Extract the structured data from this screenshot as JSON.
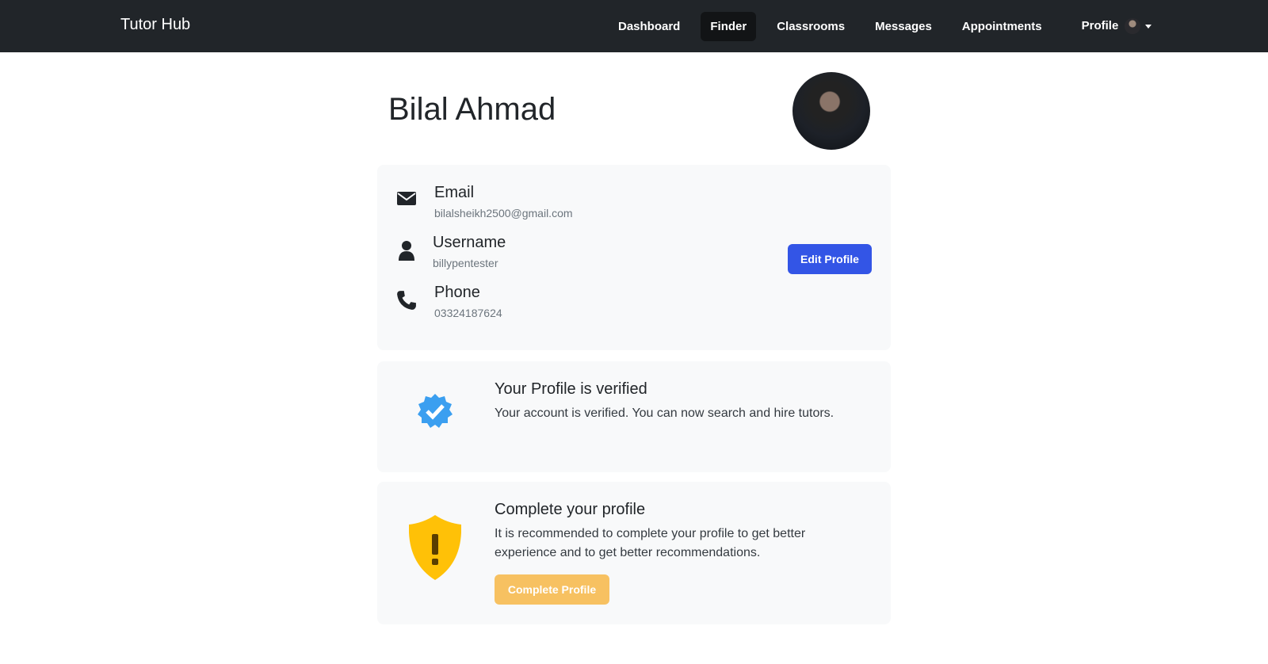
{
  "nav": {
    "brand": "Tutor Hub",
    "links": [
      "Dashboard",
      "Finder",
      "Classrooms",
      "Messages",
      "Appointments"
    ],
    "active": "Finder",
    "profile": "Profile"
  },
  "profile": {
    "name": "Bilal Ahmad",
    "fields": [
      {
        "label": "Email",
        "value": "bilalsheikh2500@gmail.com",
        "icon": "envelope-icon"
      },
      {
        "label": "Username",
        "value": "billypentester",
        "icon": "user-icon"
      },
      {
        "label": "Phone",
        "value": "03324187624",
        "icon": "phone-icon"
      }
    ],
    "edit_button": "Edit Profile"
  },
  "verified": {
    "title": "Your Profile is verified",
    "text": "Your account is verified. You can now search and hire tutors.",
    "icon": "verified-badge-icon",
    "color": "#3b9ff0"
  },
  "complete": {
    "title": "Complete your profile",
    "text": "It is recommended to complete your profile to get better experience and to get better recommendations.",
    "button": "Complete Profile",
    "icon": "warning-shield-icon",
    "color": "#ffc107"
  }
}
